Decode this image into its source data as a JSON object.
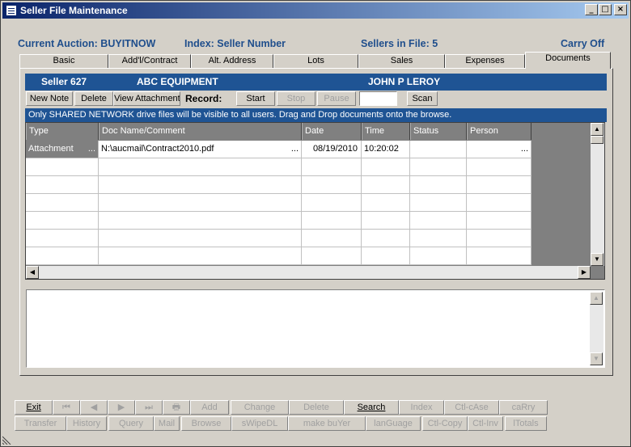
{
  "window": {
    "title": "Seller File Maintenance",
    "controls": {
      "minimize": "_",
      "maximize": "□",
      "close": "×"
    }
  },
  "header": {
    "auction": "Current Auction: BUYITNOW",
    "index": "Index: Seller Number",
    "sellers": "Sellers in File: 5",
    "carry": "Carry Off"
  },
  "tabs": [
    {
      "label": "Basic"
    },
    {
      "label": "Add'l/Contract"
    },
    {
      "label": "Alt. Address"
    },
    {
      "label": "Lots"
    },
    {
      "label": "Sales"
    },
    {
      "label": "Expenses"
    },
    {
      "label": "Documents",
      "active": true
    }
  ],
  "seller": {
    "number": "Seller 627",
    "company": "ABC EQUIPMENT",
    "contact": "JOHN P LEROY"
  },
  "toolbar": {
    "new_note": "New Note",
    "delete": "Delete",
    "view_attachment": "View Attachment",
    "record_label": "Record:",
    "start": "Start",
    "stop": "Stop",
    "pause": "Pause",
    "record_value": "",
    "scan": "Scan"
  },
  "info": "Only SHARED NETWORK drive files will be visible to all users. Drag and Drop documents onto the browse.",
  "grid": {
    "columns": [
      "Type",
      "Doc Name/Comment",
      "Date",
      "Time",
      "Status",
      "Person"
    ],
    "rows": [
      {
        "type": "Attachment",
        "doc": "N:\\aucmail\\Contract2010.pdf",
        "date": "08/19/2010",
        "time": "10:20:02",
        "status": "",
        "person": ""
      }
    ],
    "ellipsis": "..."
  },
  "bottom_buttons": {
    "row1": [
      "Exit",
      "⏮",
      "◀",
      "▶",
      "⏭",
      "🖶",
      "Add",
      "Change",
      "Delete",
      "Search",
      "Index",
      "Ctl-cAse",
      "caRry"
    ],
    "row2": [
      "Transfer",
      "History",
      "Query",
      "Mail",
      "Browse",
      "sWipeDL",
      "make buYer",
      "lanGuage",
      "Ctl-Copy",
      "Ctl-Inv",
      "lTotals"
    ]
  },
  "colors": {
    "title_bar": "#0a246a",
    "band": "#1f5494",
    "header_text": "#1f4e8c"
  }
}
